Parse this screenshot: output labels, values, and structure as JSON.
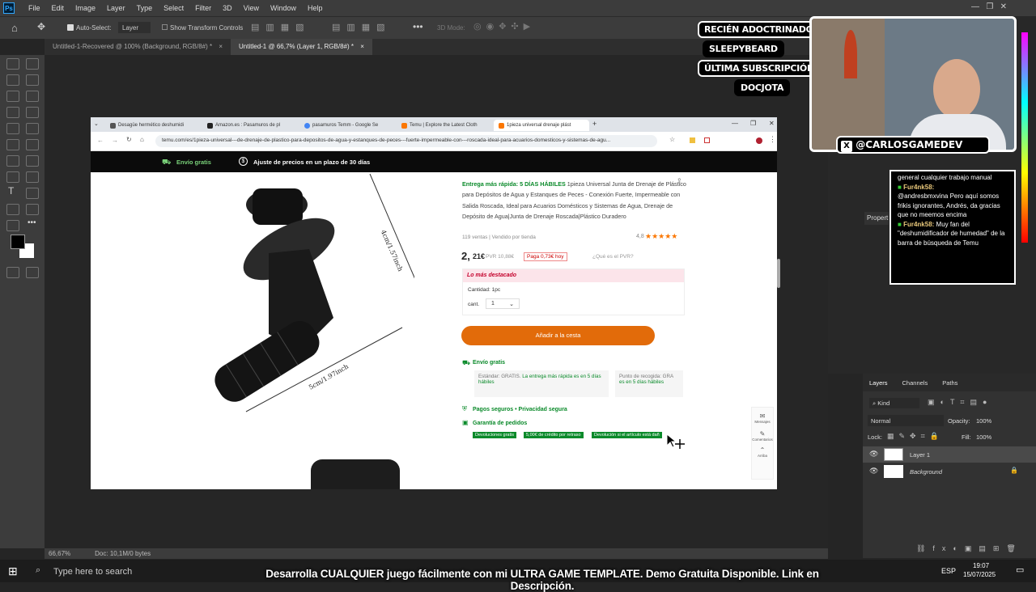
{
  "ps": {
    "menu": [
      "File",
      "Edit",
      "Image",
      "Layer",
      "Type",
      "Select",
      "Filter",
      "3D",
      "View",
      "Window",
      "Help"
    ],
    "options": {
      "auto_select": "Auto-Select:",
      "layer_select": "Layer",
      "show_transform": "Show Transform Controls",
      "mode_3d": "3D Mode:"
    },
    "doc_tabs": [
      {
        "label": "Untitled-1-Recovered @ 100% (Background, RGB/8#) *",
        "close": "×"
      },
      {
        "label": "Untitled-1 @ 66,7% (Layer 1, RGB/8#) *",
        "close": "×"
      }
    ],
    "status": {
      "zoom": "66,67%",
      "doc": "Doc: 10,1M/0 bytes"
    }
  },
  "browser": {
    "tabs": [
      {
        "label": "Desagüe hermético deshumidi",
        "color": "#555555"
      },
      {
        "label": "Amazon.es : Pasamuros de pl",
        "color": "#222222"
      },
      {
        "label": "pasamuros Temm - Google Se",
        "color": "#4285f4"
      },
      {
        "label": "Temu | Explore the Latest Cloth",
        "color": "#fb7701"
      },
      {
        "label": "1pieza universal drenaje plást",
        "color": "#fb7701"
      }
    ],
    "url": "temu.com/es/1pieza-universal---de-drenaje-de-plastico-para-depositos-de-agua-y-estanques-de-peces---fuerte-impermeable-con---roscada-ideal-para-acuarios-domesticos-y-sistemas-de-agu...",
    "banner": {
      "shipping": "Envío gratis",
      "adjust": "Ajuste de precios en un plazo de 30 días"
    },
    "product": {
      "delivery": "Entrega más rápida: 5 DÍAS HÁBILES",
      "title": " 1pieza Universal Junta de Drenaje de Plástico para Depósitos de Agua y Estanques de Peces - Conexión Fuerte, Impermeable con Salida Roscada, Ideal para Acuarios Domésticos y Sistemas de Agua, Drenaje de Depósito de Agua|Junta de Drenaje Roscada|Plástico Duradero",
      "sold": "119 ventas | Vendido por tienda",
      "rating": "4,8",
      "stars": "★★★★★",
      "price_int": "2,",
      "price_dec": "21€",
      "pvr": "PVR 10,88€",
      "pay_today": "Paga 0,73€ hoy",
      "pvr_q": "¿Qué es el PVR?",
      "featured": "Lo más destacado",
      "qty_label": "Cantidad: 1pc",
      "cant": "cant.",
      "cant_val": "1",
      "add_cart": "Añadir a la cesta",
      "free_ship": "Envío gratis",
      "standard": "Estándar: GRATIS.",
      "standard_green": "La entrega más rápida es en 5 días hábiles",
      "pickup": "Punto de recogida: GRA",
      "pickup_green": "es en 5 días hábiles",
      "secure": "Pagos seguros • Privacidad segura",
      "guarantee": "Garantía de pedidos",
      "badges": [
        "Devoluciones gratis",
        "5,00€ de crédito por retraso",
        "Devolución si el artículo está dañ"
      ],
      "dim1": "4cm/1.57inch",
      "dim2": "5cm/1.97inch",
      "side": [
        "Mensajes",
        "Comentarios",
        "Arriba"
      ]
    }
  },
  "stream": {
    "labels": [
      "RECIÉN ADOCTRINADO",
      "SLEEPYBEARD",
      "ÚLTIMA SUBSCRIPCIÓN",
      "DOCJOTA"
    ],
    "handle": "@CARLOSGAMEDEV",
    "chat": [
      {
        "user": "",
        "text": "general cualquier trabajo manual"
      },
      {
        "user": "Fur4nk58:",
        "text": "@andresbmxvina Pero aquí somos frikis ignorantes, Andrés, da gracias que no meemos encima"
      },
      {
        "user": "Fur4nk58:",
        "text": "Muy fan del \"deshumidificador de humedad\" de la barra de búsqueda de Temu"
      }
    ],
    "ticker": "Desarrolla CUALQUIER juego fácilmente con mi ULTRA GAME TEMPLATE. Demo Gratuita Disponible. Link en Descripción."
  },
  "layers": {
    "tabs": [
      "Layers",
      "Channels",
      "Paths"
    ],
    "kind": "Kind",
    "blend": "Normal",
    "opacity_label": "Opacity:",
    "opacity": "100%",
    "lock": "Lock:",
    "fill_label": "Fill:",
    "fill": "100%",
    "items": [
      "Layer 1",
      "Background"
    ],
    "props": "Propert"
  },
  "taskbar": {
    "search": "Type here to search",
    "lang": "ESP",
    "time": "19:07",
    "date": "15/07/2025"
  }
}
